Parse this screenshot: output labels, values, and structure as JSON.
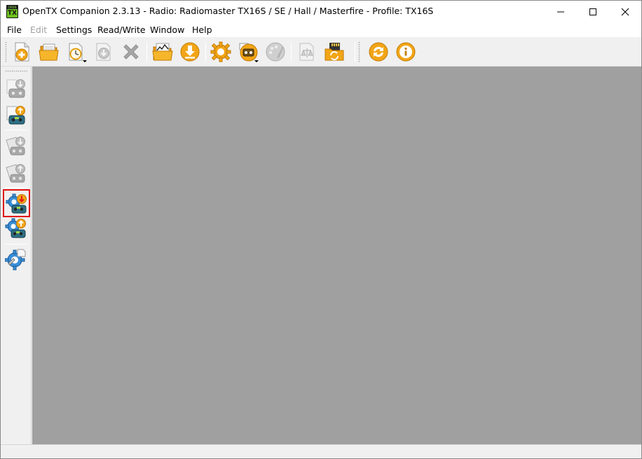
{
  "window": {
    "title": "OpenTX Companion 2.3.13 - Radio: Radiomaster TX16S / SE / Hall / Masterfire - Profile: TX16S",
    "app_icon_top": "OPEN",
    "app_icon_letters": "TX"
  },
  "menubar": {
    "items": [
      {
        "label": "File",
        "enabled": true
      },
      {
        "label": "Edit",
        "enabled": false
      },
      {
        "label": "Settings",
        "enabled": true
      },
      {
        "label": "Read/Write",
        "enabled": true
      },
      {
        "label": "Window",
        "enabled": true
      },
      {
        "label": "Help",
        "enabled": true
      }
    ]
  },
  "toolbar": {
    "buttons": [
      {
        "icon": "new-file-icon"
      },
      {
        "icon": "open-folder-icon"
      },
      {
        "icon": "recent-files-icon"
      },
      {
        "icon": "save-icon",
        "enabled": false
      },
      {
        "icon": "close-icon",
        "enabled": false
      },
      {
        "icon": "open-models-folder-icon"
      },
      {
        "icon": "download-icon"
      },
      {
        "icon": "settings-gear-icon"
      },
      {
        "icon": "radio-profiles-icon"
      },
      {
        "icon": "customize-palette-icon",
        "enabled": false
      },
      {
        "icon": "compare-icon",
        "enabled": false
      },
      {
        "icon": "sd-card-sync-icon"
      },
      {
        "icon": "check-updates-icon"
      },
      {
        "icon": "about-info-icon"
      }
    ]
  },
  "sidebar": {
    "buttons": [
      {
        "icon": "read-models-icon",
        "enabled": false
      },
      {
        "icon": "write-models-to-radio-icon"
      },
      {
        "icon": "read-backup-icon",
        "enabled": false
      },
      {
        "icon": "write-backup-icon",
        "enabled": false
      },
      {
        "icon": "read-firmware-icon",
        "selected": true
      },
      {
        "icon": "write-firmware-icon"
      },
      {
        "icon": "radio-bootloader-icon"
      }
    ]
  },
  "colors": {
    "accent_orange": "#f0a818",
    "mdi_background": "#a0a0a0",
    "selection_border": "#e01010"
  }
}
